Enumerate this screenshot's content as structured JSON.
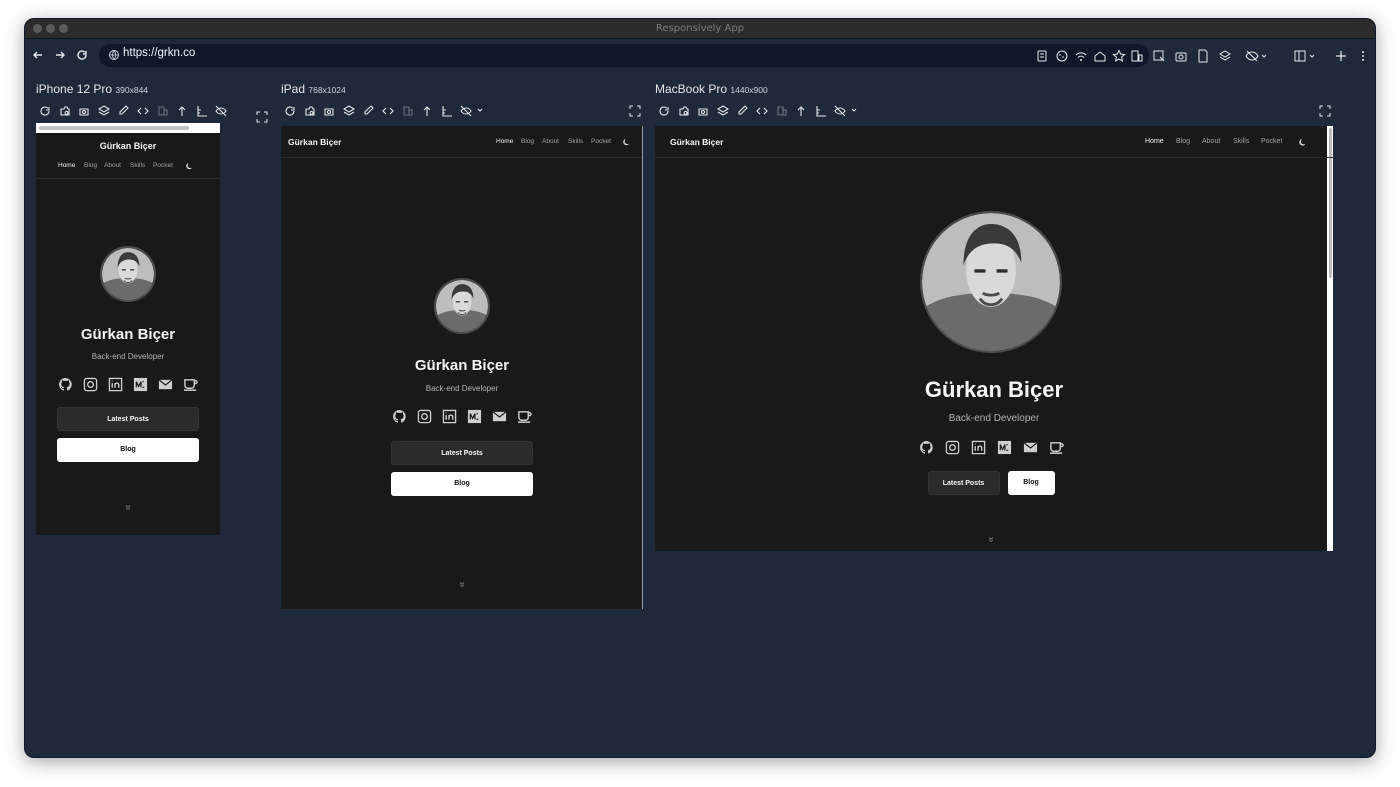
{
  "window": {
    "title": "Responsively App"
  },
  "browser": {
    "url": "https://grkn.co"
  },
  "icons": {
    "back": "arrow-left-icon",
    "forward": "arrow-right-icon",
    "reload": "reload-icon",
    "globe": "globe-icon",
    "bookmark": "star-icon",
    "menu": "more-vertical-icon",
    "new": "plus-icon"
  },
  "devices": [
    {
      "name": "iPhone 12 Pro",
      "dims": "390x844"
    },
    {
      "name": "iPad",
      "dims": "768x1024"
    },
    {
      "name": "MacBook Pro",
      "dims": "1440x900"
    }
  ],
  "site": {
    "brand": "Gürkan Biçer",
    "menu": [
      "Home",
      "Blog",
      "About",
      "Skills",
      "Pocket"
    ],
    "name": "Gürkan Biçer",
    "role": "Back-end Developer",
    "btn_latest": "Latest Posts",
    "btn_blog": "Blog",
    "chevron": "»",
    "social": [
      "github-icon",
      "instagram-icon",
      "linkedin-icon",
      "medium-icon",
      "mail-icon",
      "coffee-icon"
    ]
  },
  "colors": {
    "window_bg": "#1e293b",
    "url_bg": "#0f172a",
    "site_bg": "#191919",
    "accent_white": "#ffffff"
  }
}
